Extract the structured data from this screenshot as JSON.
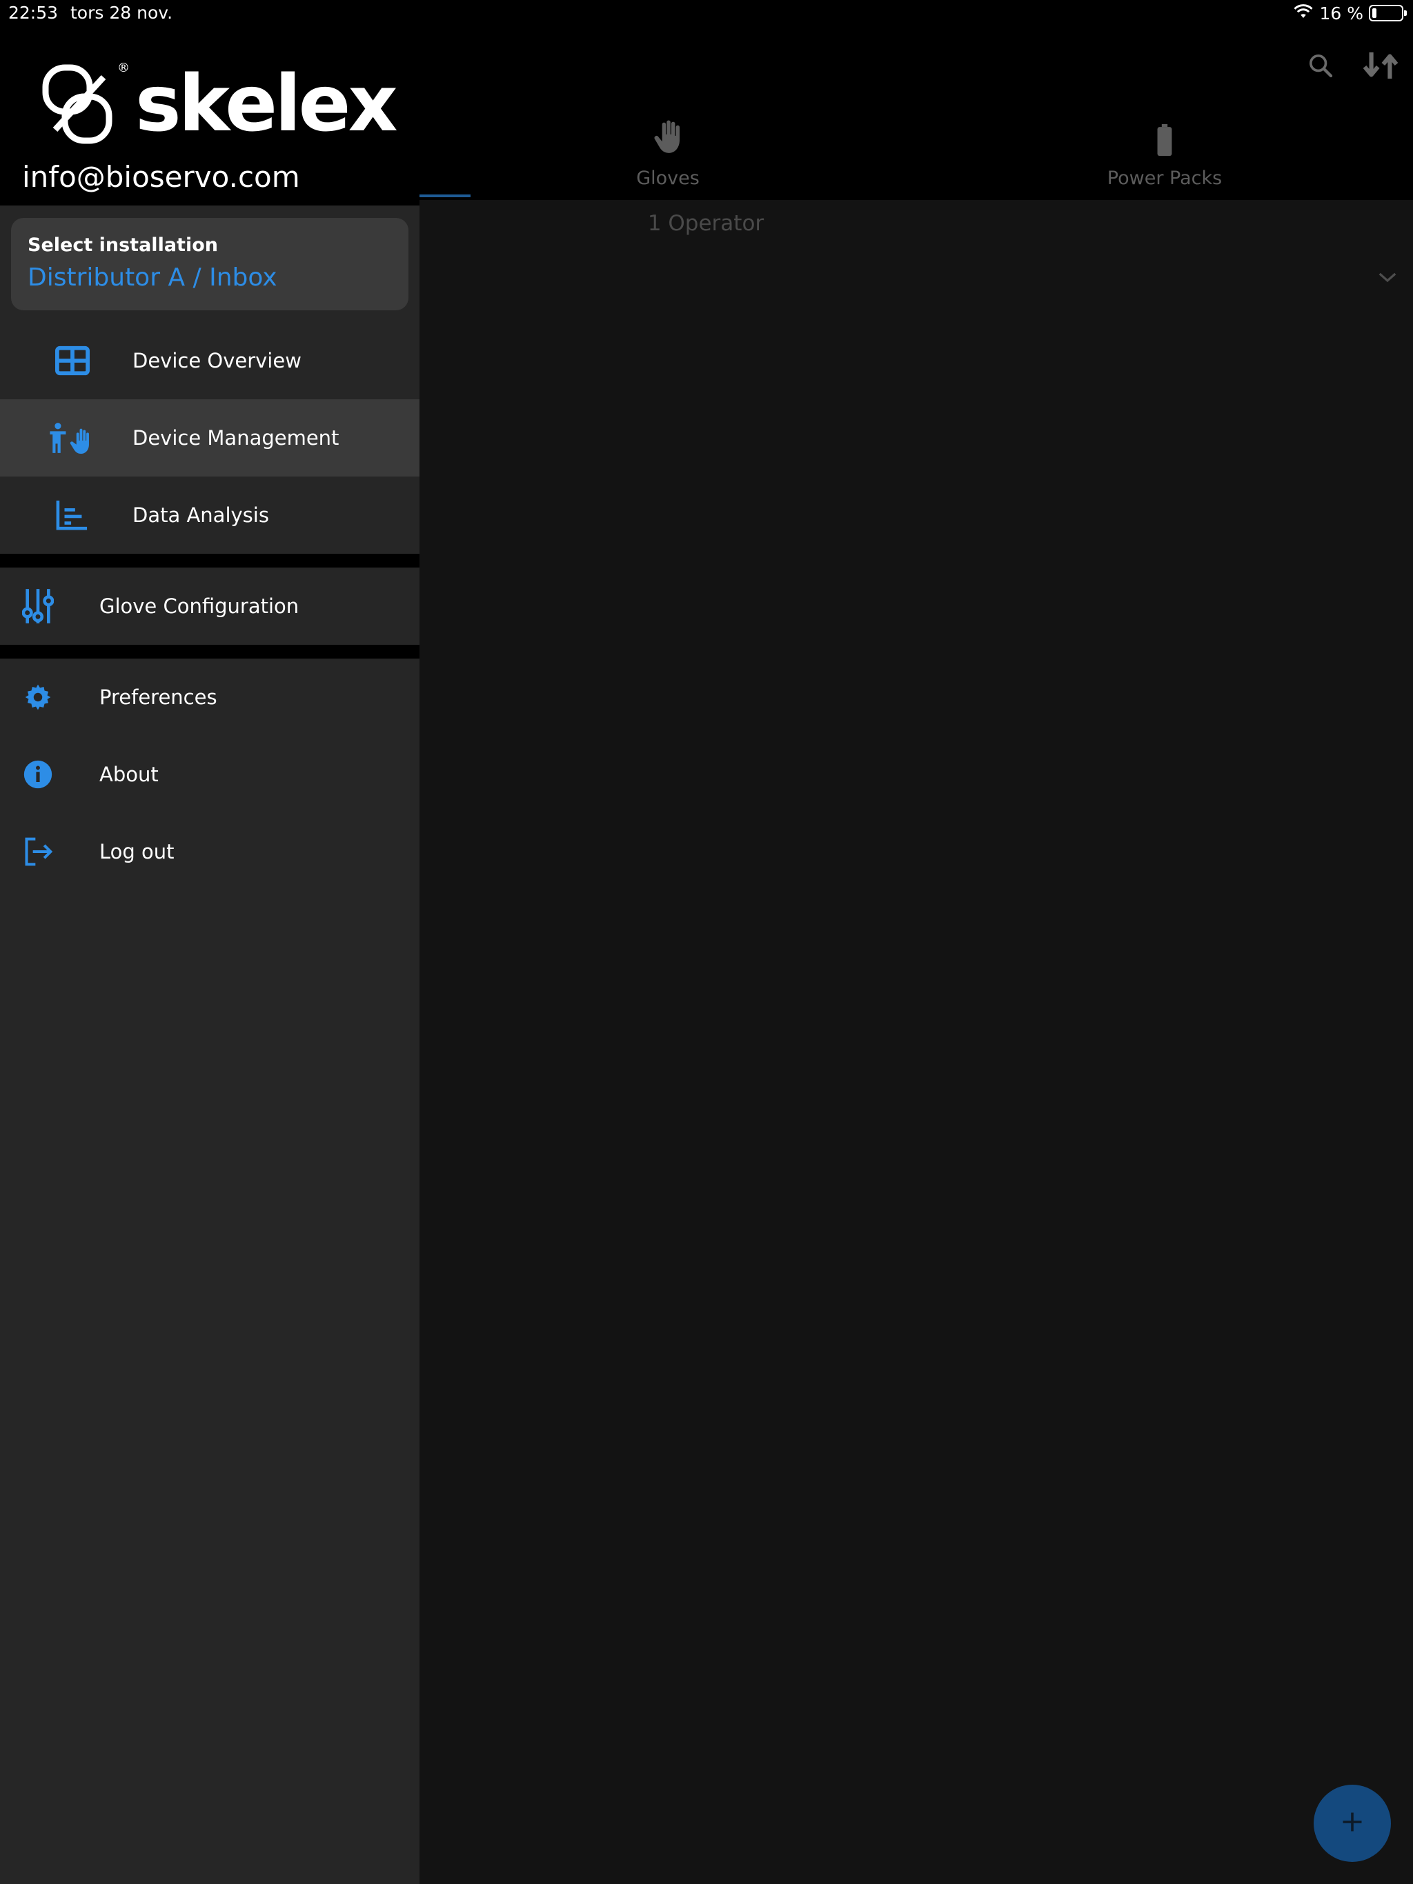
{
  "status_bar": {
    "time": "22:53",
    "date": "tors 28 nov.",
    "battery": "16 %"
  },
  "drawer": {
    "logo_text": "skelex",
    "email": "info@bioservo.com",
    "installation": {
      "label": "Select installation",
      "value": "Distributor A / Inbox"
    },
    "sub_items": [
      {
        "label": "Device Overview",
        "icon": "grid-icon"
      },
      {
        "label": "Device Management",
        "icon": "person-hand-icon",
        "active": true
      },
      {
        "label": "Data Analysis",
        "icon": "chart-icon"
      }
    ],
    "config_item": {
      "label": "Glove Configuration",
      "icon": "sliders-icon"
    },
    "bottom_items": [
      {
        "label": "Preferences",
        "icon": "gear-icon"
      },
      {
        "label": "About",
        "icon": "info-icon"
      },
      {
        "label": "Log out",
        "icon": "logout-icon"
      }
    ]
  },
  "main": {
    "tabs": [
      {
        "label": "Gloves",
        "icon": "hand-icon"
      },
      {
        "label": "Power Packs",
        "icon": "battery-icon"
      }
    ],
    "count_text": "1 Operator"
  },
  "colors": {
    "accent": "#2d8de6",
    "fab": "#14497e",
    "drawer_bg": "#262626",
    "active_bg": "#3a3a3a"
  }
}
